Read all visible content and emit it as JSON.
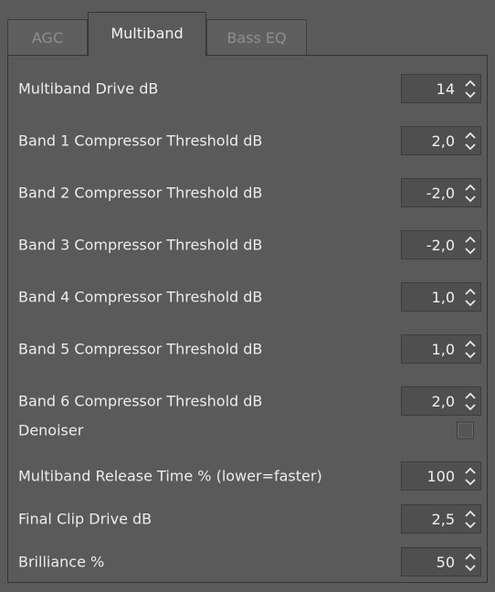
{
  "tabs": [
    {
      "label": "AGC",
      "active": false
    },
    {
      "label": "Multiband",
      "active": true
    },
    {
      "label": "Bass EQ",
      "active": false
    }
  ],
  "rows": [
    {
      "label": "Multiband Drive dB",
      "value": "14"
    },
    {
      "label": "Band 1 Compressor Threshold dB",
      "value": "2,0"
    },
    {
      "label": "Band 2 Compressor Threshold dB",
      "value": "-2,0"
    },
    {
      "label": "Band 3 Compressor Threshold dB",
      "value": "-2,0"
    },
    {
      "label": "Band 4 Compressor Threshold dB",
      "value": "1,0"
    },
    {
      "label": "Band 5 Compressor Threshold dB",
      "value": "1,0"
    },
    {
      "label": "Band 6 Compressor Threshold dB",
      "value": "2,0"
    },
    {
      "label": "Denoiser",
      "checked": false
    },
    {
      "label": "Multiband Release Time % (lower=faster)",
      "value": "100"
    },
    {
      "label": "Final Clip Drive dB",
      "value": "2,5"
    },
    {
      "label": "Brilliance %",
      "value": "50"
    }
  ],
  "colors": {
    "background": "#5a5a5a",
    "text": "#ececec",
    "inactive_tab_text": "#8e8e8e",
    "field_bg": "#4f4f4f"
  },
  "icons": {
    "spin_up": "chevron-up-icon",
    "spin_down": "chevron-down-icon"
  }
}
